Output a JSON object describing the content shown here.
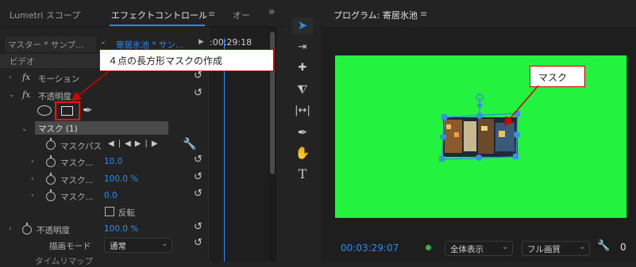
{
  "tabs": {
    "lumetri": "Lumetri スコープ",
    "effect_controls": "エフェクトコントロール",
    "menu": "≡",
    "other": "オー",
    "overflow": "»"
  },
  "header": {
    "master": "マスター * サンプ...",
    "clip": "寄居氷池 * サン...",
    "time": ":00;29:18"
  },
  "section_video": "ビデオ",
  "motion": "モーション",
  "opacity": "不透明度",
  "mask_name": "マスク (1)",
  "mask_path": "マスクパス",
  "mask_feather_label": "マスク...",
  "mask_feather": "10.0",
  "mask_opacity_label": "マスク...",
  "mask_opacity": "100.0 %",
  "mask_expansion_label": "マスク...",
  "mask_expansion": "0.0",
  "invert": "反転",
  "opacity_value_label": "不透明度",
  "opacity_value": "100.0 %",
  "blend_mode_label": "描画モード",
  "blend_mode": "通常",
  "time_remap": "タイムリマップ",
  "callout_rect": "４点の長方形マスクの作成",
  "callout_mask": "マスク",
  "program": {
    "title": "プログラム: 寄居氷池",
    "menu": "≡",
    "timecode": "00:03:29:07",
    "fit": "全体表示",
    "quality": "フル画質",
    "count": "0"
  },
  "colors": {
    "accent": "#2d8ceb",
    "green_screen": "#23f23f",
    "callout_border": "#cc0000"
  }
}
